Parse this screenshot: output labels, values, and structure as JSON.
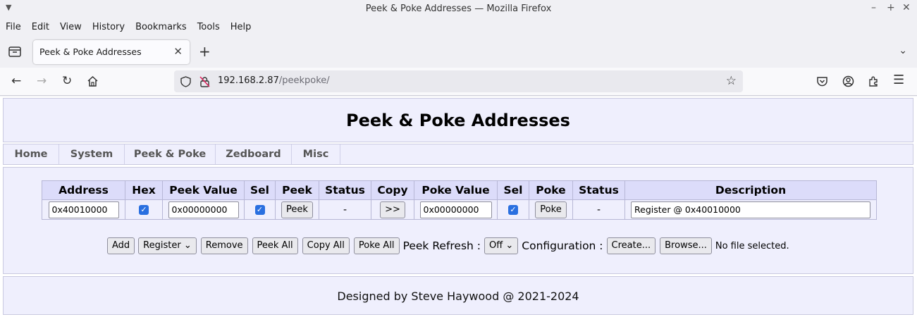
{
  "window": {
    "title": "Peek & Poke Addresses — Mozilla Firefox",
    "controls": [
      "–",
      "+",
      "✕"
    ]
  },
  "menu": [
    "File",
    "Edit",
    "View",
    "History",
    "Bookmarks",
    "Tools",
    "Help"
  ],
  "tab": {
    "label": "Peek & Poke Addresses",
    "close": "✕"
  },
  "url": {
    "host": "192.168.2.87",
    "path": "/peekpoke/"
  },
  "page": {
    "title": "Peek & Poke Addresses",
    "nav": [
      "Home",
      "System",
      "Peek & Poke",
      "Zedboard",
      "Misc"
    ],
    "table": {
      "headers": [
        "Address",
        "Hex",
        "Peek Value",
        "Sel",
        "Peek",
        "Status",
        "Copy",
        "Poke Value",
        "Sel",
        "Poke",
        "Status",
        "Description"
      ],
      "row": {
        "address": "0x40010000",
        "hex_checked": true,
        "peek_value": "0x00000000",
        "peek_sel_checked": true,
        "peek_button": "Peek",
        "peek_status": "-",
        "copy_button": ">>",
        "poke_value": "0x00000000",
        "poke_sel_checked": true,
        "poke_button": "Poke",
        "poke_status": "-",
        "description": "Register @ 0x40010000"
      }
    },
    "controls": {
      "add": "Add",
      "type_select": "Register",
      "remove": "Remove",
      "peek_all": "Peek All",
      "copy_all": "Copy All",
      "poke_all": "Poke All",
      "peek_refresh_label": "Peek Refresh :",
      "peek_refresh_value": "Off",
      "configuration_label": "Configuration :",
      "create": "Create...",
      "browse": "Browse...",
      "file_status": "No file selected."
    },
    "footer": "Designed by Steve Haywood @ 2021-2024"
  }
}
